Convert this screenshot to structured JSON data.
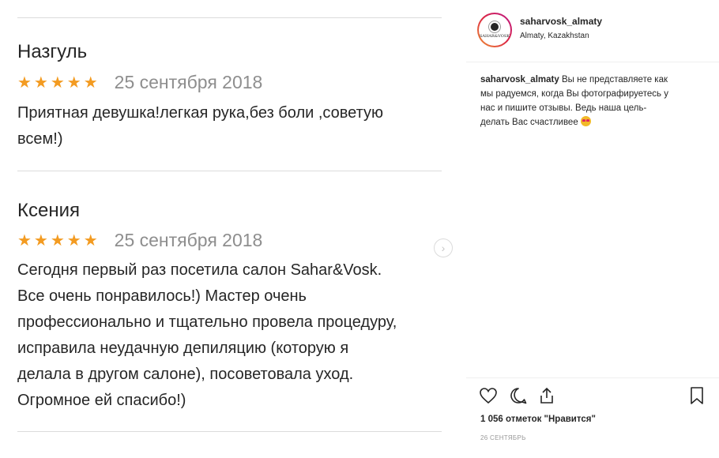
{
  "reviews": [
    {
      "author": "Назгуль",
      "stars": "★★★★★",
      "date": "25 сентября 2018",
      "lines": [
        "Приятная девушка!легкая рука,без боли ,советую",
        "всем!)"
      ]
    },
    {
      "author": "Ксения",
      "stars": "★★★★★",
      "date": "25 сентября 2018",
      "lines": [
        "Сегодня первый раз посетила салон Sahar&Vosk.",
        "Все очень понравилось!) Мастер очень",
        "профессионально и тщательно провела процедуру,",
        "исправила неудачную депиляцию (которую я",
        "делала в другом салоне), посоветовала уход.",
        "Огромное ей спасибо!)"
      ]
    }
  ],
  "post": {
    "username": "saharvosk_almaty",
    "location": "Almaty, Kazakhstan",
    "avatar_text": "SAHAR&VOSK",
    "caption_username": "saharvosk_almaty",
    "caption_lines": [
      "Вы не представляете как",
      "мы радуемся, когда Вы фотографируетесь у",
      "нас и пишите отзывы. Ведь наша цель-",
      "делать Вас счастливее"
    ],
    "likes": "1 056 отметок \"Нравится\"",
    "date": "26 СЕНТЯБРЬ"
  },
  "icons": {
    "like": "heart-icon",
    "comment": "comment-icon",
    "share": "share-icon",
    "save": "bookmark-icon",
    "next": "chevron-right-icon"
  },
  "colors": {
    "stars": "#f39b21",
    "accent": "#dc2743"
  }
}
